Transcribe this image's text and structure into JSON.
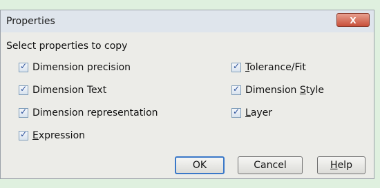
{
  "window": {
    "title": "Properties",
    "close_label": "X"
  },
  "section_label": "Select properties to copy",
  "left_options": [
    {
      "label": "Dimension precision",
      "checked": true
    },
    {
      "label": "Dimension Text",
      "checked": true
    },
    {
      "label": "Dimension representation",
      "checked": true
    },
    {
      "label_pre": "",
      "label_accel": "E",
      "label_post": "xpression",
      "checked": true
    }
  ],
  "right_options": [
    {
      "label_pre": "",
      "label_accel": "T",
      "label_post": "olerance/Fit",
      "checked": true
    },
    {
      "label_pre": "Dimension ",
      "label_accel": "S",
      "label_post": "tyle",
      "checked": true
    },
    {
      "label_pre": "",
      "label_accel": "L",
      "label_post": "ayer",
      "checked": true
    }
  ],
  "buttons": {
    "ok": "OK",
    "cancel": "Cancel",
    "help_pre": "",
    "help_accel": "H",
    "help_post": "elp"
  }
}
